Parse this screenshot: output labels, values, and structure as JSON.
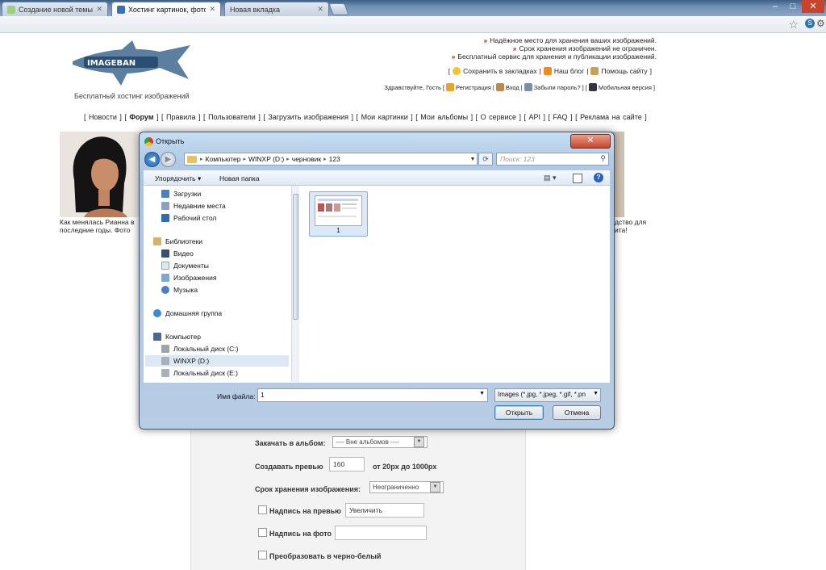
{
  "browser": {
    "tabs": [
      {
        "label": "Создание новой темы - Ф",
        "active": false
      },
      {
        "label": "Хостинг картинок, фотохо",
        "active": true
      },
      {
        "label": "Новая вкладка",
        "active": false
      }
    ],
    "window_controls": [
      "–",
      "□",
      "✕"
    ],
    "icons": [
      "bookmark-star-icon",
      "extension-icon",
      "wrench-icon"
    ]
  },
  "site": {
    "logo_text": "IMAGEBAN",
    "tagline": "Бесплатный хостинг изображений",
    "promo": [
      "Надёжное место для хранения ваших изображений.",
      "Срок хранения изображений не ограничен.",
      "Бесплатный сервис для хранения и публикации изображений."
    ],
    "links1": [
      "Сохранить в закладках",
      "Наш блог",
      "Помощь сайту"
    ],
    "links2": {
      "greeting": "Здравствуйте, Гость",
      "items": [
        "Регистрация",
        "Вход",
        "Забыли пароль?",
        "Мобильная версия"
      ]
    },
    "nav": [
      "Новости",
      "Форум",
      "Правила",
      "Пользователи",
      "Загрузить изображения",
      "Мои картинки",
      "Мои альбомы",
      "О сервисе",
      "API",
      "FAQ",
      "Реклама на сайте"
    ],
    "caption_left": [
      "Как менялась Рианна в",
      "последние годы. Фото"
    ],
    "caption_right": [
      "дство для",
      "ита!"
    ],
    "form": {
      "album_label": "Закачать в альбом:",
      "album_value": "---- Вне альбомов ----",
      "preview_label": "Создавать превью",
      "preview_value": "160",
      "preview_range": "от 20px до 1000px",
      "storage_label": "Срок хранения изображения:",
      "storage_value": "Неограниченно",
      "caption_preview_label": "Надпись на превью",
      "caption_preview_value": "Увеличить",
      "caption_photo_label": "Надпись на фото",
      "bw_label": "Преобразовать в черно-белый"
    }
  },
  "dialog": {
    "title": "Открыть",
    "close": "✕",
    "path": [
      "Компьютер",
      "WINXP (D:)",
      "черновик",
      "123"
    ],
    "search_placeholder": "Поиск: 123",
    "organize": "Упорядочить ▾",
    "new_folder": "Новая папка",
    "help": "?",
    "nav_items": [
      {
        "label": "Загрузки",
        "icon": "downloads-folder-icon",
        "group": false
      },
      {
        "label": "Недавние места",
        "icon": "recent-places-icon",
        "group": false
      },
      {
        "label": "Рабочий стол",
        "icon": "desktop-icon",
        "group": false
      },
      {
        "label": "Библиотеки",
        "icon": "libraries-icon",
        "group": true
      },
      {
        "label": "Видео",
        "icon": "video-icon",
        "group": false
      },
      {
        "label": "Документы",
        "icon": "documents-icon",
        "group": false
      },
      {
        "label": "Изображения",
        "icon": "pictures-icon",
        "group": false
      },
      {
        "label": "Музыка",
        "icon": "music-icon",
        "group": false
      },
      {
        "label": "Домашняя группа",
        "icon": "homegroup-icon",
        "group": true
      },
      {
        "label": "Компьютер",
        "icon": "computer-icon",
        "group": true
      },
      {
        "label": "Локальный диск (C:)",
        "icon": "drive-c-icon",
        "group": false
      },
      {
        "label": "WINXP (D:)",
        "icon": "drive-d-icon",
        "group": false,
        "selected": true
      },
      {
        "label": "Локальный диск (E:)",
        "icon": "drive-e-icon",
        "group": false
      }
    ],
    "file": {
      "name": "1"
    },
    "filename_label": "Имя файла:",
    "filename_value": "1",
    "filetype": "Images (*.jpg, *.jpeg, *.gif, *.pn",
    "open_button": "Открыть",
    "cancel_button": "Отмена"
  },
  "colors": {
    "accent": "#1f5fa8",
    "promo_arrow": "#dd0000"
  }
}
